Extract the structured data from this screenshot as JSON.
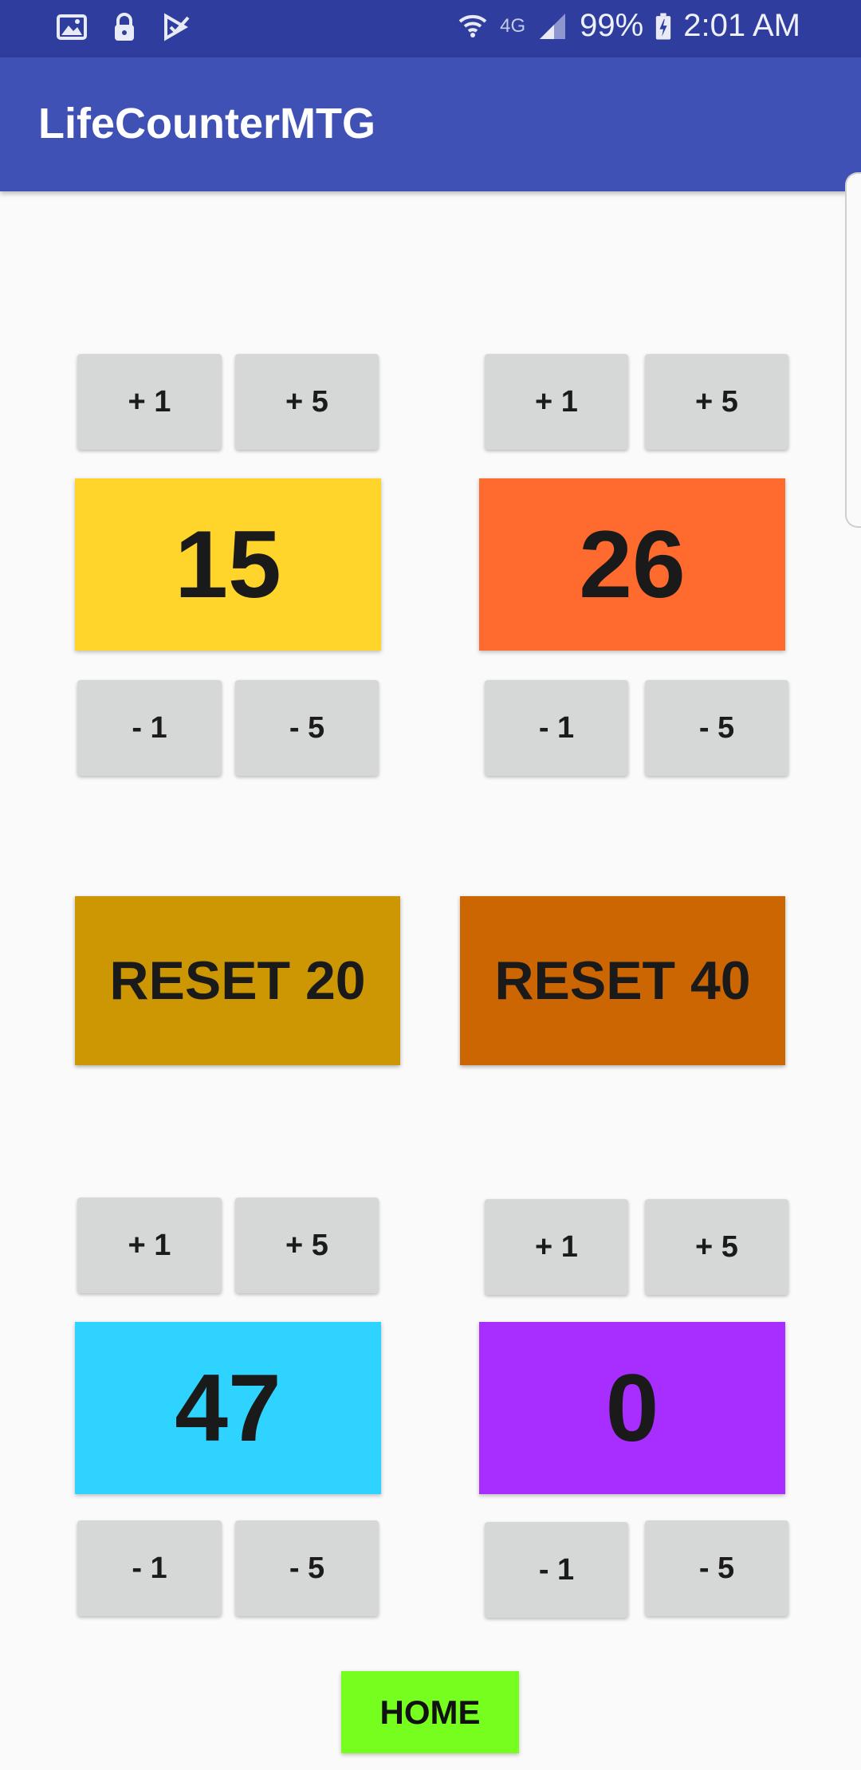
{
  "status_bar": {
    "icons_left": [
      "image-icon",
      "lock-icon",
      "task-check-icon"
    ],
    "network": "4G",
    "battery": "99%",
    "time": "2:01 AM"
  },
  "app_bar": {
    "title": "LifeCounterMTG"
  },
  "players": [
    {
      "life": "15",
      "color": "#FFD52B",
      "plus1": "+ 1",
      "plus5": "+ 5",
      "minus1": "- 1",
      "minus5": "- 5"
    },
    {
      "life": "26",
      "color": "#FF6B2E",
      "plus1": "+ 1",
      "plus5": "+ 5",
      "minus1": "- 1",
      "minus5": "- 5"
    },
    {
      "life": "47",
      "color": "#2ED4FF",
      "plus1": "+ 1",
      "plus5": "+ 5",
      "minus1": "- 1",
      "minus5": "- 5"
    },
    {
      "life": "0",
      "color": "#A82EFF",
      "plus1": "+ 1",
      "plus5": "+ 5",
      "minus1": "- 1",
      "minus5": "- 5"
    }
  ],
  "reset": {
    "reset20_label": "RESET 20",
    "reset20_color": "#CC9702",
    "reset40_label": "RESET 40",
    "reset40_color": "#CC6602"
  },
  "home": {
    "label": "HOME",
    "color": "#76FF1E"
  }
}
